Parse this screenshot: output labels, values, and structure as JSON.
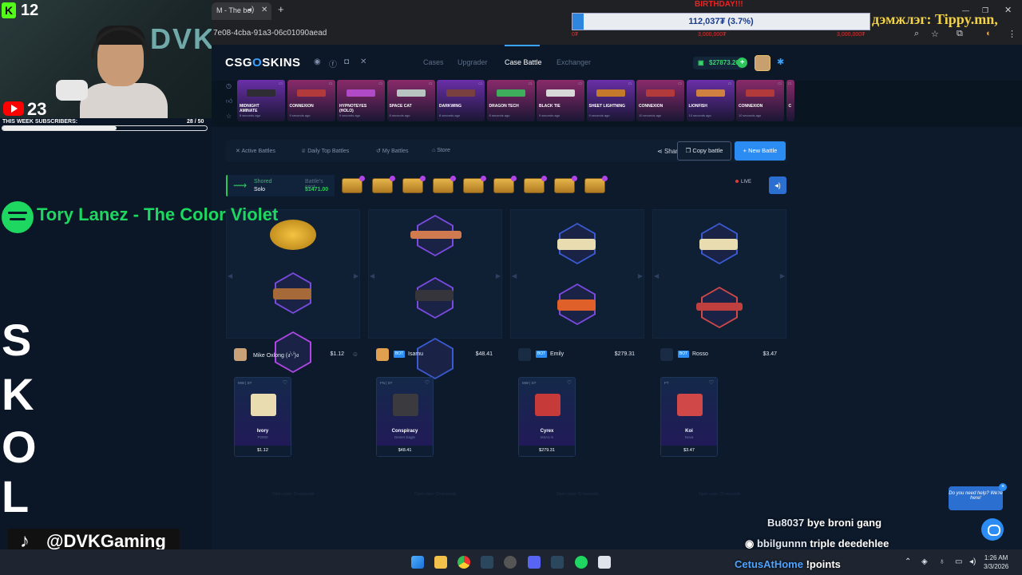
{
  "browser": {
    "tab_title": "M - The be",
    "new_tab_icon": "plus-icon",
    "address": "7e08-4cba-91a3-06c01090aead"
  },
  "overlay": {
    "kick_count": "12",
    "cam_brand": "DVK",
    "yt_count": "23",
    "subs_label": "THIS WEEK SUBSCRIBERS:",
    "subs_count": "28 / 50",
    "subs_progress": 0.56,
    "spotify_track": "Tory Lanez - The Color Violet",
    "tiktok_handle": "@DVKGaming",
    "deco_glyphs": [
      "S",
      "K",
      "O",
      "L"
    ]
  },
  "birthday": {
    "title": "BIRTHDAY!!!",
    "amount": "112,037₮ (3.7%)",
    "progress": 0.037,
    "names": [
      "0₮",
      "3,000,000₮",
      "3,000,000₮"
    ],
    "donor": "дэмжлэг: Tippy.mn,"
  },
  "site": {
    "logo_a": "CSG",
    "logo_dot": "O",
    "logo_b": "SKINS",
    "nav": [
      "Cases",
      "Upgrader",
      "Case Battle",
      "Exchanger"
    ],
    "balance": "$27873.26",
    "ticker": [
      {
        "name": "MIDNIGHT\nAMINATE",
        "ago": "8 seconds ago",
        "color": "#6a2fa8",
        "gun": "#2d2d33"
      },
      {
        "name": "CONNEXION",
        "ago": "9 seconds ago",
        "color": "#8a2a6a",
        "gun": "#b23a3a"
      },
      {
        "name": "HYPNOTEYES\n(HOLO)",
        "ago": "9 seconds ago",
        "color": "#8a2a6a",
        "gun": "#b04ac6"
      },
      {
        "name": "SPACE CAT",
        "ago": "8 seconds ago",
        "color": "#8a2a6a",
        "gun": "#b8c4c0"
      },
      {
        "name": "DARKWING",
        "ago": "8 seconds ago",
        "color": "#6a2fa8",
        "gun": "#7a4040"
      },
      {
        "name": "DRAGON TECH",
        "ago": "8 seconds ago",
        "color": "#8a2a6a",
        "gun": "#3fae5c"
      },
      {
        "name": "BLACK TIE",
        "ago": "9 seconds ago",
        "color": "#8a2a6a",
        "gun": "#d8d8d8"
      },
      {
        "name": "SHEET LIGHTNING",
        "ago": "9 seconds ago",
        "color": "#6a2fa8",
        "gun": "#c47a2a"
      },
      {
        "name": "CONNEXION",
        "ago": "10 seconds ago",
        "color": "#8a2a6a",
        "gun": "#b23a3a"
      },
      {
        "name": "LIONFISH",
        "ago": "10 seconds ago",
        "color": "#6a2fa8",
        "gun": "#d08040"
      },
      {
        "name": "CONNEXION",
        "ago": "10 seconds ago",
        "color": "#8a2a6a",
        "gun": "#b23a3a"
      },
      {
        "name": "C",
        "ago": "",
        "color": "#8a2a6a",
        "gun": "#444"
      }
    ],
    "subnav": [
      "Active Battles",
      "Daily Top Battles",
      "My Battles",
      "Store"
    ],
    "share": "Share",
    "copy_battle": "Copy battle",
    "new_battle": "+ New Battle",
    "mode_type": "Shored",
    "mode_players": "Solo",
    "cost_label": "Battle's cost",
    "cost_value": "$1471.00",
    "cases_count": 9,
    "live": "LIVE",
    "players": [
      {
        "name": "Mike Oxlong (ง'̀-'́)ง",
        "bot": false,
        "total": "$1.12",
        "avatar": "#c9a27a",
        "win": {
          "cond": "MW | ST",
          "name": "Ivory",
          "weapon": "P2000",
          "price": "$1.12",
          "gun": "#e8dcb0"
        },
        "foot": "Open case: Crossroads"
      },
      {
        "name": "Isamu",
        "bot": true,
        "total": "$48.41",
        "avatar": "#e0a050",
        "win": {
          "cond": "FN | ST",
          "name": "Conspiracy",
          "weapon": "Desert Eagle",
          "price": "$48.41",
          "gun": "#3a3a3f"
        },
        "foot": "Open case: Crossroads"
      },
      {
        "name": "Emily",
        "bot": true,
        "total": "$279.31",
        "avatar": "#1a2c44",
        "win": {
          "cond": "MW | ST",
          "name": "Cyrex",
          "weapon": "M4A1-S",
          "price": "$279.31",
          "gun": "#c73a3a"
        },
        "foot": "Open case: Crossroads"
      },
      {
        "name": "Rosso",
        "bot": true,
        "total": "$3.47",
        "avatar": "#1a2c44",
        "win": {
          "cond": "FT",
          "name": "Koi",
          "weapon": "Nova",
          "price": "$3.47",
          "gun": "#d04848"
        },
        "foot": "Open case: Crossroads"
      }
    ]
  },
  "support": {
    "text": "Do you need help? We're here!"
  },
  "chat": [
    {
      "user": "Bu8037",
      "msg": "bye broni gang"
    },
    {
      "user": "bbilgunnn",
      "msg": "triple deedehlee"
    },
    {
      "user": "CetusAtHome",
      "msg": "!points"
    }
  ],
  "taskbar": {
    "time": "1:26 AM",
    "date": "3/3/2026"
  }
}
